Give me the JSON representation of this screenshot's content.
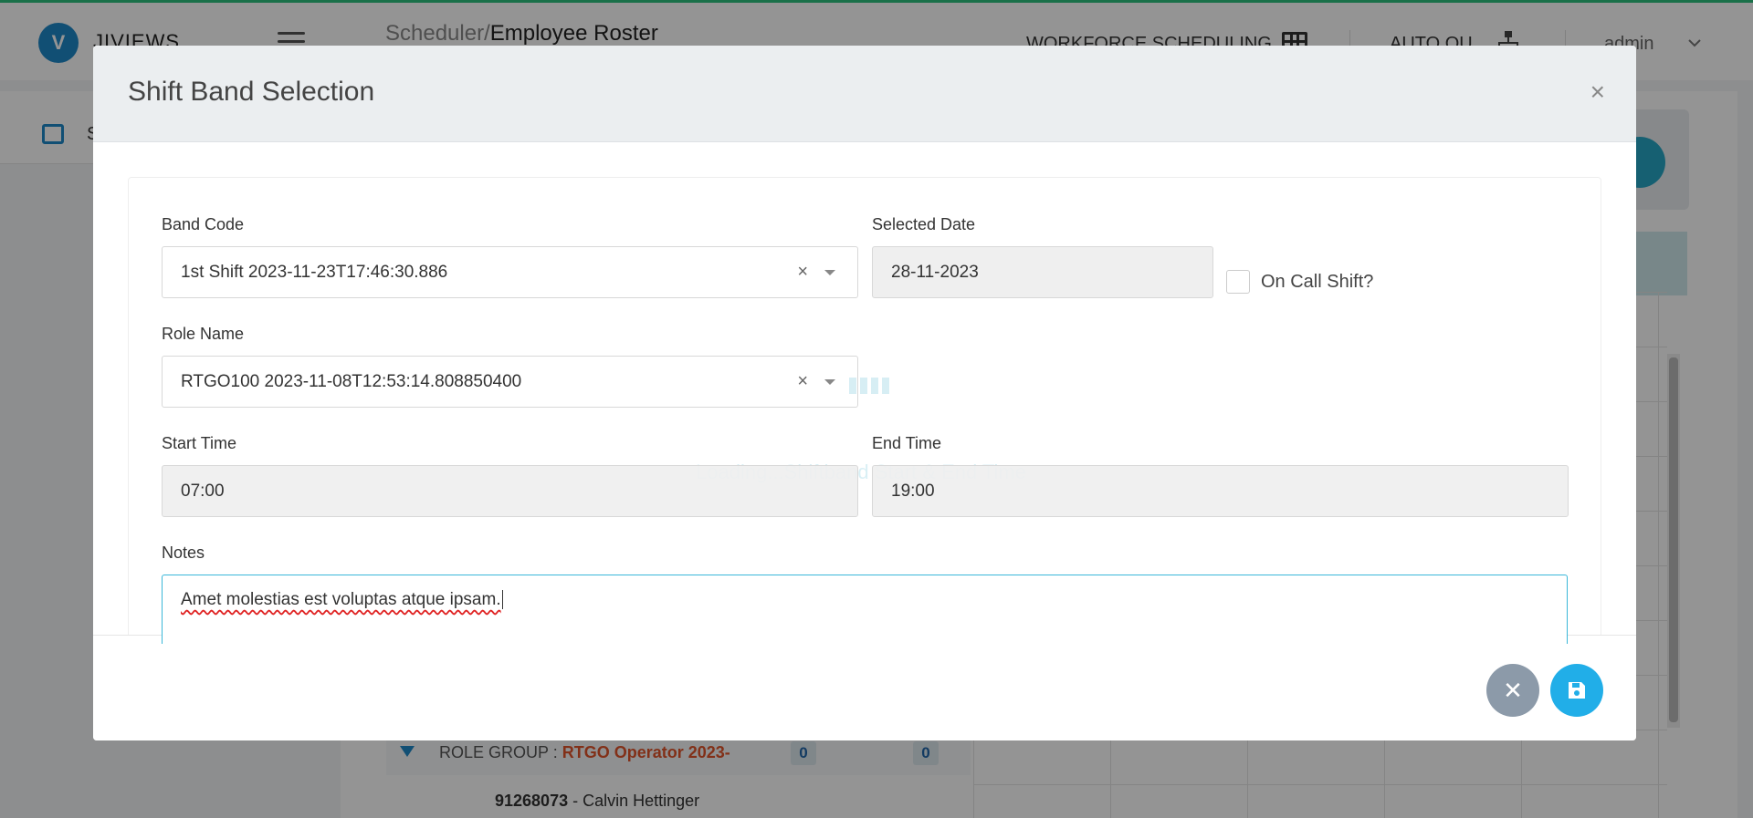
{
  "app": {
    "logo_letter": "V",
    "brand": "JIVIEWS",
    "breadcrumb_parent": "Scheduler/",
    "breadcrumb_current": "Employee Roster",
    "top_menu_1": "WORKFORCE SCHEDULING",
    "top_menu_2": "AUTO OU",
    "user": "admin",
    "sidebar_letter": "S"
  },
  "background_table": {
    "role_group_prefix": "ROLE GROUP : ",
    "role_group_name": "RTGO Operator 2023-",
    "badge_1": "0",
    "badge_2": "0",
    "employee_id": "91268073",
    "employee_name": " - Calvin Hettinger"
  },
  "modal": {
    "title": "Shift Band Selection",
    "close_symbol": "×",
    "band_code": {
      "label": "Band Code",
      "value": "1st Shift 2023-11-23T17:46:30.886",
      "clear": "×"
    },
    "selected_date": {
      "label": "Selected Date",
      "value": "28-11-2023"
    },
    "on_call": {
      "label": "On Call Shift?",
      "checked": false
    },
    "role_name": {
      "label": "Role Name",
      "value": "RTGO100 2023-11-08T12:53:14.808850400",
      "clear": "×"
    },
    "start_time": {
      "label": "Start Time",
      "value": "07:00"
    },
    "end_time": {
      "label": "End Time",
      "value": "19:00"
    },
    "loading_text": "Loading...Shiftband Start & End Time",
    "notes": {
      "label": "Notes",
      "value": "Amet molestias est voluptas atque ipsam."
    },
    "cancel_symbol": "✕"
  },
  "colors": {
    "accent": "#21aee8",
    "cancel_button": "#8c9aa9",
    "top_border": "#2ec27e",
    "role_group_accent": "#e0542a"
  }
}
